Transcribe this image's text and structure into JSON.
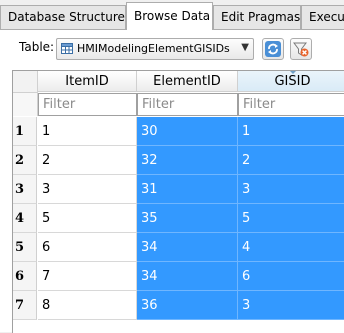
{
  "tabs": [
    {
      "label": "Database Structure",
      "active": false
    },
    {
      "label": "Browse Data",
      "active": true
    },
    {
      "label": "Edit Pragmas",
      "active": false
    },
    {
      "label": "Execute SQL",
      "active": false
    }
  ],
  "toolbar": {
    "table_label": "Table:",
    "table_selected": "HMIModelingElementGISIDs",
    "icons": [
      "refresh-icon",
      "clear-filters-icon"
    ]
  },
  "grid": {
    "columns": [
      "ItemID",
      "ElementID",
      "GISID"
    ],
    "filter_placeholder": "Filter",
    "sorted_column": "GISID",
    "rows": [
      {
        "num": "1",
        "cells": [
          "1",
          "30",
          "1"
        ]
      },
      {
        "num": "2",
        "cells": [
          "2",
          "32",
          "2"
        ]
      },
      {
        "num": "3",
        "cells": [
          "3",
          "31",
          "3"
        ]
      },
      {
        "num": "4",
        "cells": [
          "5",
          "35",
          "5"
        ]
      },
      {
        "num": "5",
        "cells": [
          "6",
          "34",
          "4"
        ]
      },
      {
        "num": "6",
        "cells": [
          "7",
          "34",
          "6"
        ]
      },
      {
        "num": "7",
        "cells": [
          "8",
          "36",
          "3"
        ]
      }
    ],
    "selected_columns": [
      "ElementID",
      "GISID"
    ],
    "selection_color": "#3399ff"
  }
}
